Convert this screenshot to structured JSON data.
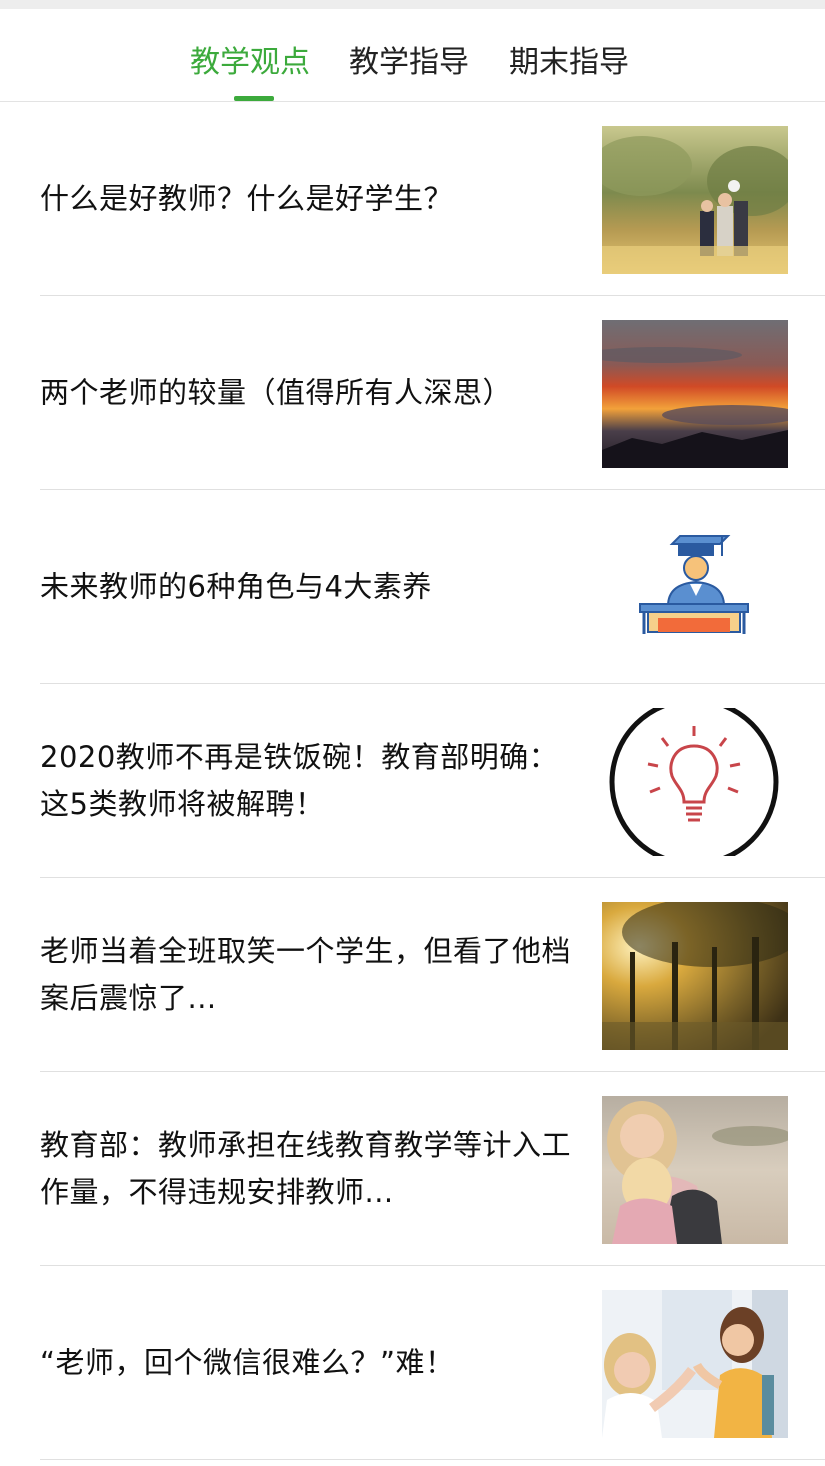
{
  "tabs": [
    {
      "label": "教学观点",
      "active": true
    },
    {
      "label": "教学指导",
      "active": false
    },
    {
      "label": "期末指导",
      "active": false
    }
  ],
  "colors": {
    "accent": "#3caa3c",
    "divider": "#e0e0e0"
  },
  "articles": [
    {
      "title": "什么是好教师？什么是好学生？",
      "image": "family-in-field-photo"
    },
    {
      "title": "两个老师的较量（值得所有人深思）",
      "image": "sunset-clouds-photo"
    },
    {
      "title": "未来教师的6种角色与4大素养",
      "image": "graduate-at-desk-icon"
    },
    {
      "title": "2020教师不再是铁饭碗！教育部明确：这5类教师将被解聘！",
      "image": "lightbulb-icon"
    },
    {
      "title": "老师当着全班取笑一个学生，但看了他档案后震惊了...",
      "image": "sunlit-trees-photo"
    },
    {
      "title": "教育部：教师承担在线教育教学等计入工作量，不得违规安排教师...",
      "image": "mother-hugging-child-photo"
    },
    {
      "title": "“老师，回个微信很难么？”难！",
      "image": "teacher-high-five-student-photo"
    }
  ]
}
